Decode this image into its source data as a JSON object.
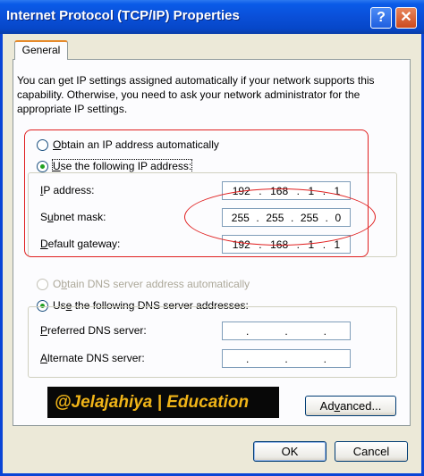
{
  "window": {
    "title": "Internet Protocol (TCP/IP) Properties",
    "help_label": "?",
    "close_label": "✕"
  },
  "tabs": [
    {
      "label": "General",
      "active": true
    }
  ],
  "intro_text": "You can get IP settings assigned automatically if your network supports this capability. Otherwise, you need to ask your network administrator for the appropriate IP settings.",
  "ip_settings": {
    "auto_option": {
      "prefix": "",
      "accel": "O",
      "rest": "btain an IP address automatically",
      "selected": false
    },
    "manual_option": {
      "prefix": "",
      "accel": "U",
      "rest": "se the following IP address:",
      "selected": true
    },
    "fields": [
      {
        "accel": "I",
        "rest": "P address:",
        "octets": [
          "192",
          "168",
          "1",
          "1"
        ]
      },
      {
        "accel": "",
        "pre": "S",
        "accel2": "u",
        "rest": "bnet mask:",
        "octets": [
          "255",
          "255",
          "255",
          "0"
        ]
      },
      {
        "accel": "D",
        "rest": "efault gateway:",
        "octets": [
          "192",
          "168",
          "1",
          "1"
        ]
      }
    ]
  },
  "dns_settings": {
    "auto_option": {
      "pre": "O",
      "accel": "b",
      "rest": "tain DNS server address automatically",
      "selected": false,
      "disabled": true
    },
    "manual_option": {
      "pre": "Us",
      "accel": "e",
      "rest": " the following DNS server addresses:",
      "selected": true
    },
    "fields": [
      {
        "accel": "P",
        "rest": "referred DNS server:",
        "dot": "."
      },
      {
        "accel": "A",
        "rest": "lternate DNS server:",
        "dot": "."
      }
    ]
  },
  "watermark": "@Jelajahiya | Education",
  "buttons": {
    "advanced": {
      "pre": "Ad",
      "accel": "v",
      "rest": "anced..."
    },
    "ok": "OK",
    "cancel": "Cancel"
  },
  "colors": {
    "titlebar": "#0a4fd8",
    "dialog_bg": "#ece9d8",
    "annotation": "#e02020",
    "watermark_text": "#f0b418",
    "watermark_bg": "#080808"
  }
}
